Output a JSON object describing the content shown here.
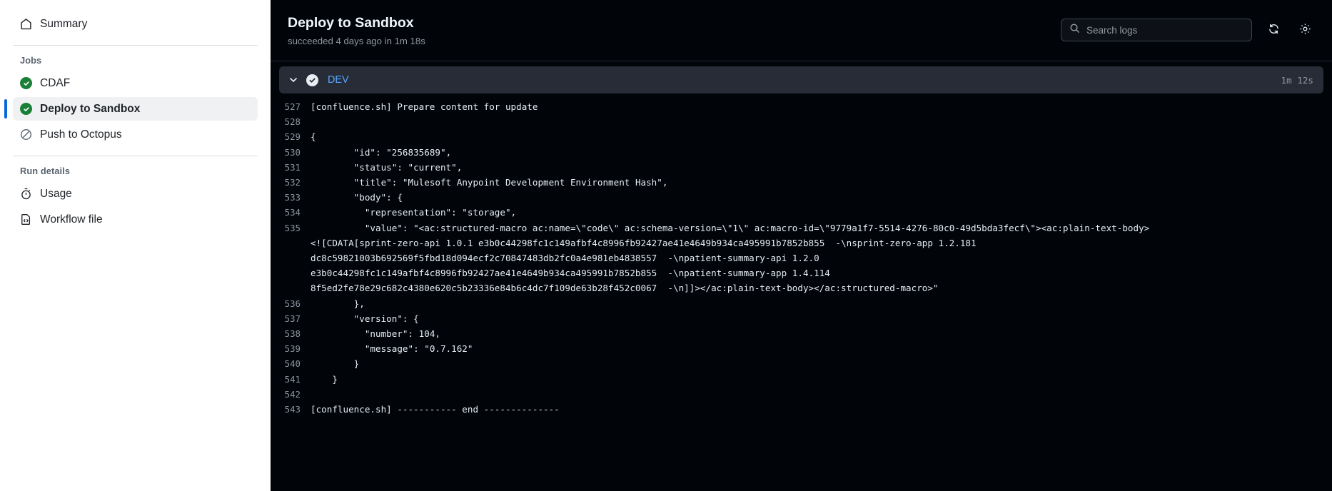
{
  "sidebar": {
    "summary": {
      "label": "Summary",
      "icon": "home-icon"
    },
    "jobs_heading": "Jobs",
    "jobs": [
      {
        "label": "CDAF",
        "status": "success",
        "icon": "check-circle-icon",
        "selected": false
      },
      {
        "label": "Deploy to Sandbox",
        "status": "success",
        "icon": "check-circle-icon",
        "selected": true
      },
      {
        "label": "Push to Octopus",
        "status": "skipped",
        "icon": "skip-circle-icon",
        "selected": false
      }
    ],
    "run_details_heading": "Run details",
    "run_details": [
      {
        "label": "Usage",
        "icon": "stopwatch-icon"
      },
      {
        "label": "Workflow file",
        "icon": "file-code-icon"
      }
    ]
  },
  "header": {
    "title": "Deploy to Sandbox",
    "subtitle": "succeeded 4 days ago in 1m 18s",
    "search": {
      "placeholder": "Search logs",
      "value": "",
      "icon": "search-icon"
    },
    "refresh_icon": "sync-icon",
    "settings_icon": "gear-icon"
  },
  "job": {
    "name": "DEV",
    "duration": "1m 12s",
    "status": "success",
    "expanded": true,
    "chevron_icon": "chevron-down-icon",
    "status_icon": "check-circle-icon"
  },
  "log": {
    "lines": [
      {
        "num": "527",
        "text": "[confluence.sh] Prepare content for update"
      },
      {
        "num": "528",
        "text": ""
      },
      {
        "num": "529",
        "text": "{"
      },
      {
        "num": "530",
        "text": "        \"id\": \"256835689\","
      },
      {
        "num": "531",
        "text": "        \"status\": \"current\","
      },
      {
        "num": "532",
        "text": "        \"title\": \"Mulesoft Anypoint Development Environment Hash\","
      },
      {
        "num": "533",
        "text": "        \"body\": {"
      },
      {
        "num": "534",
        "text": "          \"representation\": \"storage\","
      },
      {
        "num": "535",
        "text": "          \"value\": \"<ac:structured-macro ac:name=\\\"code\\\" ac:schema-version=\\\"1\\\" ac:macro-id=\\\"9779a1f7-5514-4276-80c0-49d5bda3fecf\\\"><ac:plain-text-body>"
      },
      {
        "num": "",
        "text": "<![CDATA[sprint-zero-api 1.0.1 e3b0c44298fc1c149afbf4c8996fb92427ae41e4649b934ca495991b7852b855  -\\nsprint-zero-app 1.2.181"
      },
      {
        "num": "",
        "text": "dc8c59821003b692569f5fbd18d094ecf2c70847483db2fc0a4e981eb4838557  -\\npatient-summary-api 1.2.0"
      },
      {
        "num": "",
        "text": "e3b0c44298fc1c149afbf4c8996fb92427ae41e4649b934ca495991b7852b855  -\\npatient-summary-app 1.4.114"
      },
      {
        "num": "",
        "text": "8f5ed2fe78e29c682c4380e620c5b23336e84b6c4dc7f109de63b28f452c0067  -\\n]]></ac:plain-text-body></ac:structured-macro>\""
      },
      {
        "num": "536",
        "text": "        },"
      },
      {
        "num": "537",
        "text": "        \"version\": {"
      },
      {
        "num": "538",
        "text": "          \"number\": 104,"
      },
      {
        "num": "539",
        "text": "          \"message\": \"0.7.162\""
      },
      {
        "num": "540",
        "text": "        }"
      },
      {
        "num": "541",
        "text": "    }"
      },
      {
        "num": "542",
        "text": ""
      },
      {
        "num": "543",
        "text": "[confluence.sh] ----------- end --------------"
      }
    ]
  },
  "colors": {
    "success_green": "#1a7f37",
    "accent_blue": "#0969da",
    "link_blue": "#58a6ff",
    "log_bg": "#010409",
    "job_header_bg": "#272c36"
  }
}
